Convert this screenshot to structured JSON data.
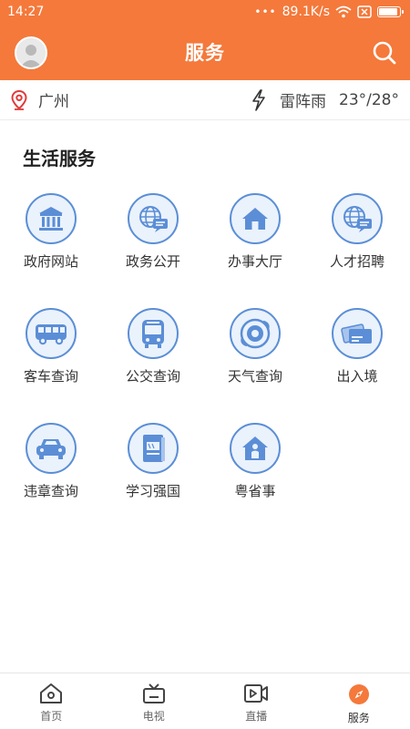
{
  "status": {
    "time": "14:27",
    "dots": "•••",
    "speed": "89.1K/s"
  },
  "header": {
    "title": "服务"
  },
  "location": {
    "city": "广州",
    "weather": "雷阵雨",
    "temperature": "23°/28°"
  },
  "section": {
    "title": "生活服务"
  },
  "services": [
    {
      "label": "政府网站",
      "icon": "government-building-icon"
    },
    {
      "label": "政务公开",
      "icon": "globe-chat-icon"
    },
    {
      "label": "办事大厅",
      "icon": "house-icon"
    },
    {
      "label": "人才招聘",
      "icon": "globe-chat-icon"
    },
    {
      "label": "客车查询",
      "icon": "coach-bus-icon"
    },
    {
      "label": "公交查询",
      "icon": "city-bus-icon"
    },
    {
      "label": "天气查询",
      "icon": "weather-swirl-icon"
    },
    {
      "label": "出入境",
      "icon": "id-cards-icon"
    },
    {
      "label": "违章查询",
      "icon": "car-icon"
    },
    {
      "label": "学习强国",
      "icon": "study-book-icon"
    },
    {
      "label": "粤省事",
      "icon": "person-house-icon"
    }
  ],
  "tabs": [
    {
      "label": "首页",
      "icon": "home-icon"
    },
    {
      "label": "电视",
      "icon": "tv-icon"
    },
    {
      "label": "直播",
      "icon": "live-video-icon"
    },
    {
      "label": "服务",
      "icon": "compass-icon"
    }
  ],
  "colors": {
    "brand": "#f4793b",
    "icon_stroke": "#5b8ed6",
    "icon_fill": "#eaf2fc"
  }
}
